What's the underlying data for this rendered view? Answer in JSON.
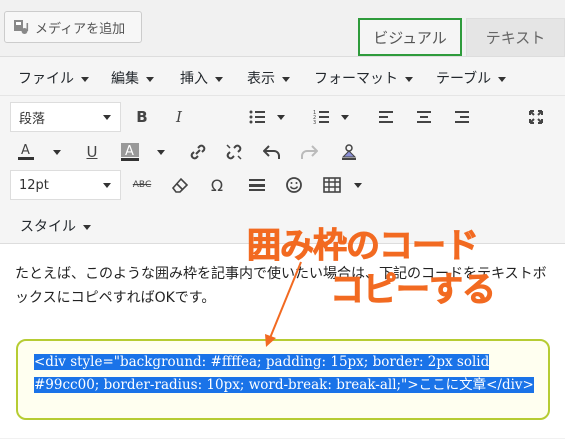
{
  "top": {
    "media_button": "メディアを追加",
    "tab_visual": "ビジュアル",
    "tab_text": "テキスト"
  },
  "menubar": [
    "ファイル",
    "編集",
    "挿入",
    "表示",
    "フォーマット",
    "テーブル"
  ],
  "toolbar": {
    "format_select": "段落",
    "font_size_select": "12pt",
    "style_menu": "スタイル",
    "icons": [
      "bold-icon",
      "italic-icon",
      "bullet-list-icon",
      "numbered-list-icon",
      "blockquote-icon",
      "align-left-icon",
      "align-center-icon",
      "align-right-icon",
      "link-icon",
      "insert-more-icon",
      "fullscreen-icon",
      "text-color-icon",
      "underline-icon",
      "background-color-icon",
      "link-icon",
      "unlink-icon",
      "undo-icon",
      "redo-icon",
      "clear-format-icon",
      "strikethrough-icon",
      "eraser-icon",
      "special-char-icon",
      "horizontal-rule-icon",
      "emoticon-icon",
      "table-icon"
    ]
  },
  "content": {
    "paragraph": "たとえば、このような囲み枠を記事内で使いたい場合は、下記のコードをテキストボックスにコピペすればOKです。",
    "code": "<div style=\"background: #ffffea; padding: 15px; border: 2px solid #99cc00; border-radius: 10px; word-break: break-all;\">ここに文章</div>",
    "annotation_line1": "囲み枠のコード",
    "annotation_line2": "コピーする"
  },
  "colors": {
    "accent_orange": "#f26a21",
    "selection_blue": "#1a73e8",
    "box_border": "#b6cc33",
    "box_bg": "#fffff0",
    "visual_tab_border": "#2e9b3b"
  }
}
